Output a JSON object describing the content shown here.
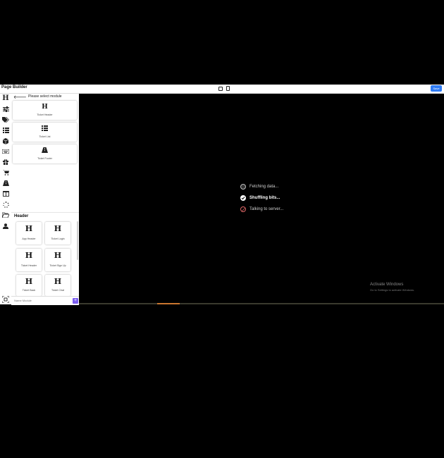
{
  "app": {
    "title": "Page Builder",
    "save_label": "Save"
  },
  "toolbar_icons": [
    "header-h-icon",
    "sliders-icon",
    "tags-icon",
    "list-icon",
    "cube-icon",
    "keyboard-icon",
    "gift-icon",
    "cart-icon",
    "road-icon",
    "columns-icon",
    "spinner-icon",
    "folder-open-icon",
    "user-icon"
  ],
  "panel": {
    "title": "Please select module",
    "modules": [
      {
        "glyph": "H",
        "label": "Ticket Header",
        "icon": "header-h-icon"
      },
      {
        "glyph": "≣",
        "label": "Ticket List",
        "icon": "list-icon"
      },
      {
        "glyph": "▲",
        "label": "Ticket Footer",
        "icon": "road-icon"
      }
    ],
    "section_title": "Header",
    "header_modules": [
      {
        "glyph": "H",
        "label": "App Header"
      },
      {
        "glyph": "H",
        "label": "Ticket Login"
      },
      {
        "glyph": "H",
        "label": "Ticket Header"
      },
      {
        "glyph": "H",
        "label": "Ticket Sign Up"
      },
      {
        "glyph": "H",
        "label": "Ticket Back"
      },
      {
        "glyph": "H",
        "label": "Ticket Chat"
      }
    ],
    "name_placeholder": "Name Module",
    "add_label": "+"
  },
  "loading": [
    {
      "text": "Fetching data...",
      "state": "pending"
    },
    {
      "text": "Shuffling bits...",
      "state": "done"
    },
    {
      "text": "Talking to server...",
      "state": "error"
    }
  ],
  "watermark": {
    "line1": "Activate Windows",
    "line2": "Go to Settings to activate Windows."
  },
  "colors": {
    "save": "#2f7cf6",
    "add": "#7a5cf0",
    "canvas": "#000000"
  }
}
